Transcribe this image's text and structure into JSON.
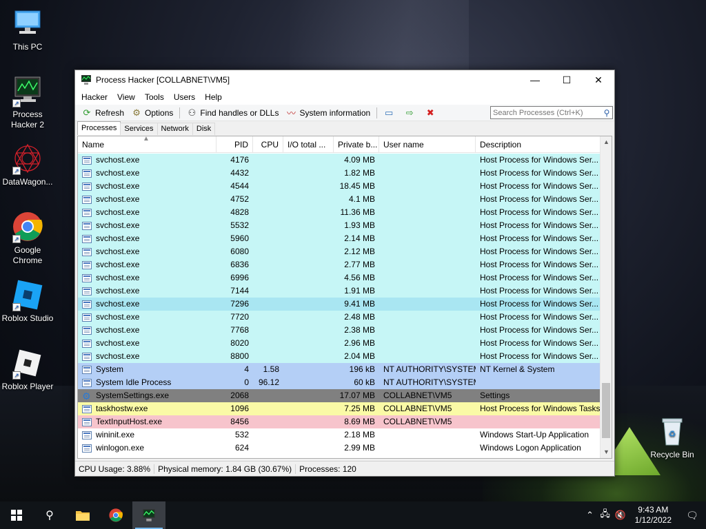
{
  "desktop": {
    "icons": [
      {
        "label": "This PC"
      },
      {
        "label": "Process Hacker 2"
      },
      {
        "label": "DataWagon..."
      },
      {
        "label": "Google Chrome"
      },
      {
        "label": "Roblox Studio"
      },
      {
        "label": "Roblox Player"
      },
      {
        "label": "Recycle Bin"
      }
    ]
  },
  "window": {
    "title": "Process Hacker [COLLABNET\\VM5]",
    "menu": [
      "Hacker",
      "View",
      "Tools",
      "Users",
      "Help"
    ],
    "toolbar": {
      "refresh": "Refresh",
      "options": "Options",
      "find_handles": "Find handles or DLLs",
      "system_information": "System information",
      "search_placeholder": "Search Processes (Ctrl+K)"
    },
    "tabs": [
      "Processes",
      "Services",
      "Network",
      "Disk"
    ],
    "columns": [
      "Name",
      "PID",
      "CPU",
      "I/O total ...",
      "Private b...",
      "User name",
      "Description"
    ],
    "rows": [
      {
        "name": "svchost.exe",
        "pid": "4176",
        "cpu": "",
        "io": "",
        "priv": "4.09 MB",
        "user": "",
        "desc": "Host Process for Windows Ser...",
        "color": "#c6f6f6"
      },
      {
        "name": "svchost.exe",
        "pid": "4432",
        "cpu": "",
        "io": "",
        "priv": "1.82 MB",
        "user": "",
        "desc": "Host Process for Windows Ser...",
        "color": "#c6f6f6"
      },
      {
        "name": "svchost.exe",
        "pid": "4544",
        "cpu": "",
        "io": "",
        "priv": "18.45 MB",
        "user": "",
        "desc": "Host Process for Windows Ser...",
        "color": "#c6f6f6"
      },
      {
        "name": "svchost.exe",
        "pid": "4752",
        "cpu": "",
        "io": "",
        "priv": "4.1 MB",
        "user": "",
        "desc": "Host Process for Windows Ser...",
        "color": "#c6f6f6"
      },
      {
        "name": "svchost.exe",
        "pid": "4828",
        "cpu": "",
        "io": "",
        "priv": "11.36 MB",
        "user": "",
        "desc": "Host Process for Windows Ser...",
        "color": "#c6f6f6"
      },
      {
        "name": "svchost.exe",
        "pid": "5532",
        "cpu": "",
        "io": "",
        "priv": "1.93 MB",
        "user": "",
        "desc": "Host Process for Windows Ser...",
        "color": "#c6f6f6"
      },
      {
        "name": "svchost.exe",
        "pid": "5960",
        "cpu": "",
        "io": "",
        "priv": "2.14 MB",
        "user": "",
        "desc": "Host Process for Windows Ser...",
        "color": "#c6f6f6"
      },
      {
        "name": "svchost.exe",
        "pid": "6080",
        "cpu": "",
        "io": "",
        "priv": "2.12 MB",
        "user": "",
        "desc": "Host Process for Windows Ser...",
        "color": "#c6f6f6"
      },
      {
        "name": "svchost.exe",
        "pid": "6836",
        "cpu": "",
        "io": "",
        "priv": "2.77 MB",
        "user": "",
        "desc": "Host Process for Windows Ser...",
        "color": "#c6f6f6"
      },
      {
        "name": "svchost.exe",
        "pid": "6996",
        "cpu": "",
        "io": "",
        "priv": "4.56 MB",
        "user": "",
        "desc": "Host Process for Windows Ser...",
        "color": "#c6f6f6"
      },
      {
        "name": "svchost.exe",
        "pid": "7144",
        "cpu": "",
        "io": "",
        "priv": "1.91 MB",
        "user": "",
        "desc": "Host Process for Windows Ser...",
        "color": "#c6f6f6"
      },
      {
        "name": "svchost.exe",
        "pid": "7296",
        "cpu": "",
        "io": "",
        "priv": "9.41 MB",
        "user": "",
        "desc": "Host Process for Windows Ser...",
        "color": "#a9e6f2"
      },
      {
        "name": "svchost.exe",
        "pid": "7720",
        "cpu": "",
        "io": "",
        "priv": "2.48 MB",
        "user": "",
        "desc": "Host Process for Windows Ser...",
        "color": "#c6f6f6"
      },
      {
        "name": "svchost.exe",
        "pid": "7768",
        "cpu": "",
        "io": "",
        "priv": "2.38 MB",
        "user": "",
        "desc": "Host Process for Windows Ser...",
        "color": "#c6f6f6"
      },
      {
        "name": "svchost.exe",
        "pid": "8020",
        "cpu": "",
        "io": "",
        "priv": "2.96 MB",
        "user": "",
        "desc": "Host Process for Windows Ser...",
        "color": "#c6f6f6"
      },
      {
        "name": "svchost.exe",
        "pid": "8800",
        "cpu": "",
        "io": "",
        "priv": "2.04 MB",
        "user": "",
        "desc": "Host Process for Windows Ser...",
        "color": "#c6f6f6"
      },
      {
        "name": "System",
        "pid": "4",
        "cpu": "1.58",
        "io": "",
        "priv": "196 kB",
        "user": "NT AUTHORITY\\SYSTEM",
        "desc": "NT Kernel & System",
        "color": "#b4cff6"
      },
      {
        "name": "System Idle Process",
        "pid": "0",
        "cpu": "96.12",
        "io": "",
        "priv": "60 kB",
        "user": "NT AUTHORITY\\SYSTEM",
        "desc": "",
        "color": "#b4cff6"
      },
      {
        "name": "SystemSettings.exe",
        "pid": "2068",
        "cpu": "",
        "io": "",
        "priv": "17.07 MB",
        "user": "COLLABNET\\VM5",
        "desc": "Settings",
        "color": "#808080",
        "icon": "gear"
      },
      {
        "name": "taskhostw.exe",
        "pid": "1096",
        "cpu": "",
        "io": "",
        "priv": "7.25 MB",
        "user": "COLLABNET\\VM5",
        "desc": "Host Process for Windows Tasks",
        "color": "#fafaa6"
      },
      {
        "name": "TextInputHost.exe",
        "pid": "8456",
        "cpu": "",
        "io": "",
        "priv": "8.69 MB",
        "user": "COLLABNET\\VM5",
        "desc": "",
        "color": "#f7c4cc"
      },
      {
        "name": "wininit.exe",
        "pid": "532",
        "cpu": "",
        "io": "",
        "priv": "2.18 MB",
        "user": "",
        "desc": "Windows Start-Up Application",
        "color": "#ffffff"
      },
      {
        "name": "winlogon.exe",
        "pid": "624",
        "cpu": "",
        "io": "",
        "priv": "2.99 MB",
        "user": "",
        "desc": "Windows Logon Application",
        "color": "#ffffff"
      }
    ],
    "status": {
      "cpu": "CPU Usage: 3.88%",
      "memory": "Physical memory: 1.84 GB (30.67%)",
      "processes": "Processes: 120"
    }
  },
  "taskbar": {
    "time": "9:43 AM",
    "date": "1/12/2022"
  }
}
